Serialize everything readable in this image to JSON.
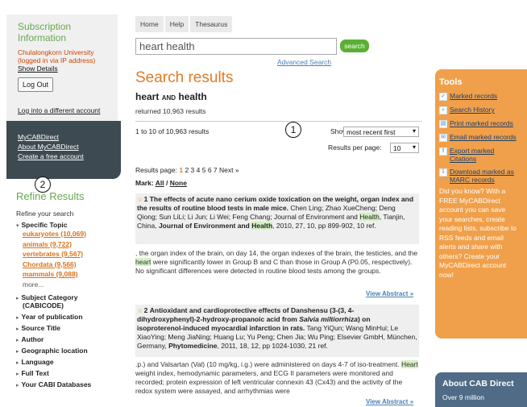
{
  "subscription": {
    "title": "Subscription Information",
    "institution": "Chulalongkorn University (logged in via IP address)",
    "show_details": "Show Details",
    "logout": "Log Out",
    "log_diff": "Log into a different account"
  },
  "mycab": {
    "items": [
      "MyCABDirect",
      "About MyCABDirect",
      "Create a free account"
    ]
  },
  "markers": {
    "one": "1",
    "two": "2"
  },
  "refine": {
    "title": "Refine Results",
    "subtitle": "Refine your search",
    "specific_topic": "Specific Topic",
    "topics": [
      "eukaryotes (10,069)",
      "animals (9,722)",
      "vertebrates (9,567)",
      "Chordata (9,566)",
      "mammals (9,088)"
    ],
    "more": "more...",
    "subject_category": "Subject Category",
    "subject_category_sub": "(CABICODE)",
    "facets": [
      "Year of publication",
      "Source Title",
      "Author",
      "Geographic location",
      "Language",
      "Full Text",
      "Your CABI Databases"
    ]
  },
  "tabs": [
    "Home",
    "Help",
    "Thesaurus"
  ],
  "search": {
    "value": "heart health",
    "button": "search",
    "advanced": "Advanced Search"
  },
  "results": {
    "heading": "Search results",
    "query_a": "heart",
    "query_and": "AND",
    "query_b": "health",
    "returned": "returned 10,963 results",
    "count": "1 to 10 of 10,963 results",
    "show_me_label": "Show me:",
    "show_me_value": "most recent first",
    "rpp_label": "Results per page:",
    "rpp_value": "10",
    "pages_label": "Results page:",
    "pages_current": "1",
    "pages_rest": "2 3 4 5 6 7 Next »",
    "mark_label": "Mark:",
    "mark_all": "All",
    "mark_none": "None",
    "view_abstract": "View Abstract »"
  },
  "records": [
    {
      "num": "1",
      "title": "The effects of acute nano cerium oxide toxication on the weight, organ index and the results of routine blood tests in male mice.",
      "authors": "Chen Ling; Zhao XueCheng; Deng Qiong; Sun LiLi; Li Jun; Li Wei; Feng Chang; Journal of Environment and",
      "hl1": "Health",
      "mid": ", Tianjin, China,",
      "journal": "Journal of Environment and",
      "hl2": "Health",
      "tail": ", 2010, 27, 10, pp 899-902, 10 ref.",
      "abs_a": ", the organ index of the brain, on day 14, the organ indexes of the brain, the testicles, and the",
      "abs_hl": "heart",
      "abs_b": "were significantly lower in Group B and C than those in Group A (P0.05, respectively). No significant differences were detected in routine blood tests among the groups."
    },
    {
      "num": "2",
      "title": "Antioxidant and cardioprotective effects of Danshensu (3-(3, 4-dihydroxyphenyl)-2-hydroxy-propanoic acid from",
      "species": "Salvia miltiorrhiza",
      "title_b": ") on isoproterenol-induced myocardial infarction in rats.",
      "authors": "Tang YiQun; Wang MinHui; Le XiaoYing; Meng JiaNing; Huang Lu; Yu Peng; Chen Jia; Wu Ping;",
      "publisher": "Elsevier GmbH, München, Germany,",
      "journal": "Phytomedicine",
      "tail": ", 2011, 18, 12, pp 1024-1030, 21 ref.",
      "abs_a": ".p.) and Valsartan (Val) (10 mg/kg, i.g.) were administered on days 4-7 of iso-treatment.",
      "abs_hl": "Heart",
      "abs_b": "weight index, hemodynamic parameters, and ECG II parameters were monitored and recorded; protein expression of left ventricular connexin 43 (Cx43) and the activity of the redox system were assayed, and arrhythmias were"
    }
  ],
  "tools": {
    "title": "Tools",
    "items": [
      "Marked records",
      "Search History",
      "Print marked records",
      "Email marked records",
      "Export marked Citations",
      "Download marked as MARC records"
    ],
    "note": "Did you know? With a FREE MyCABDirect account you can save your searches, create reading lists, subscribe to RSS feeds and email alerts and share with others? Create your MyCABDirect account now!"
  },
  "about": {
    "title": "About CAB Direct",
    "line": "Over 9 million"
  }
}
